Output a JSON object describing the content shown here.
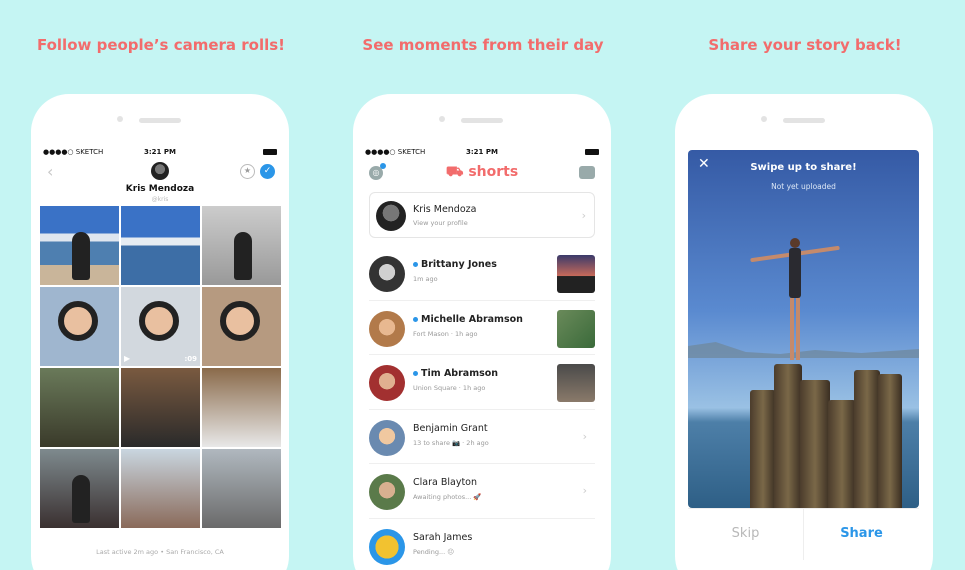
{
  "headlines": [
    "Follow people’s camera rolls!",
    "See moments from their day",
    "Share your story back!"
  ],
  "status": {
    "carrier": "●●●●○ SKETCH ",
    "time": "3:21 PM"
  },
  "phone1": {
    "name": "Kris Mendoza",
    "handle": "@kris",
    "back_icon": "chevron-left-icon",
    "video_duration": ":09",
    "last_active": "Last active 2m ago • San Francisco, CA"
  },
  "phone2": {
    "logo": "shorts",
    "me": {
      "name": "Kris Mendoza",
      "sub": "View your profile"
    },
    "rows": [
      {
        "name": "Brittany Jones",
        "sub": "1m ago",
        "unread": true
      },
      {
        "name": "Michelle Abramson",
        "sub": "Fort Mason · 1h ago",
        "unread": true
      },
      {
        "name": "Tim Abramson",
        "sub": "Union Square · 1h ago",
        "unread": true
      },
      {
        "name": "Benjamin Grant",
        "sub": "13 to share 📷 · 2h ago",
        "unread": false
      },
      {
        "name": "Clara Blayton",
        "sub": "Awaiting photos... 🚀",
        "unread": false
      },
      {
        "name": "Sarah James",
        "sub": "Pending... 😐",
        "unread": false
      }
    ]
  },
  "phone3": {
    "title": "Swipe up to share!",
    "subtitle": "Not yet uploaded",
    "skip": "Skip",
    "share": "Share"
  },
  "colors": {
    "background": "#c5f5f3",
    "accent": "#f26c6c",
    "blue": "#2b96e8"
  }
}
